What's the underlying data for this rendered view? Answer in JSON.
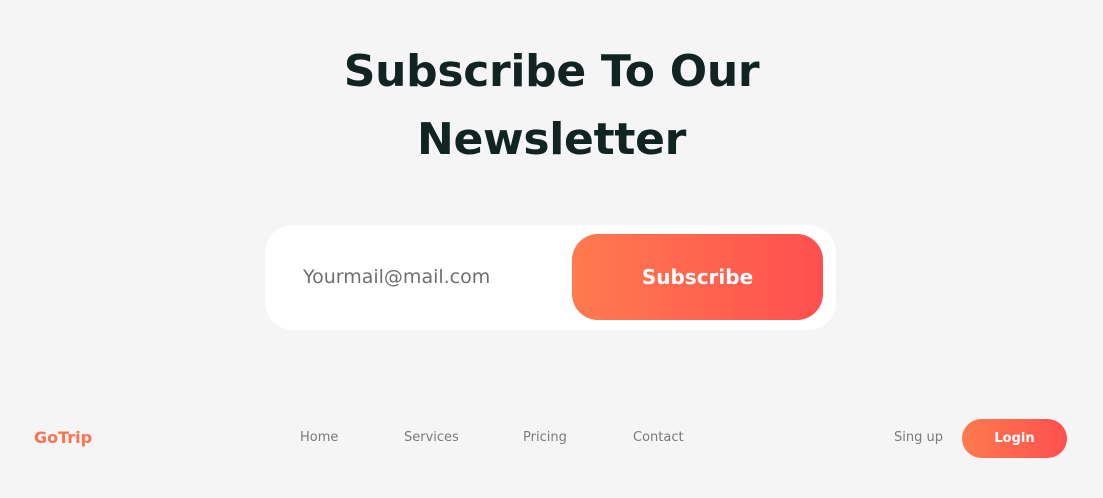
{
  "newsletter": {
    "title_line1": "Subscribe To Our",
    "title_line2": "Newsletter",
    "email_placeholder": "Yourmail@mail.com",
    "subscribe_label": "Subscribe"
  },
  "footer": {
    "brand": "GoTrip",
    "nav": {
      "home": "Home",
      "services": "Services",
      "pricing": "Pricing",
      "contact": "Contact"
    },
    "signup_label": "Sing up",
    "login_label": "Login"
  },
  "colors": {
    "background": "#f5f5f5",
    "heading": "#102422",
    "accent_start": "#ff7a4f",
    "accent_end": "#ff504f"
  }
}
